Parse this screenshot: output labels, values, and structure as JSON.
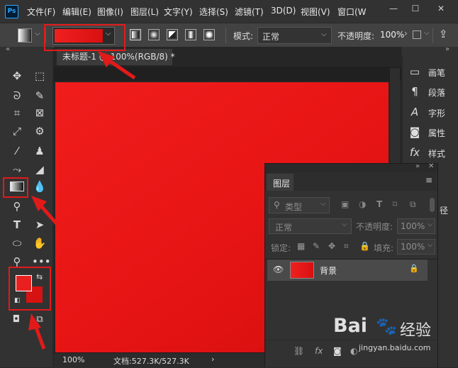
{
  "menubar": {
    "logo": "Ps",
    "items": [
      "文件(F)",
      "编辑(E)",
      "图像(I)",
      "图层(L)",
      "文字(Y)",
      "选择(S)",
      "滤镜(T)",
      "3D(D)",
      "视图(V)",
      "窗口(W"
    ]
  },
  "options": {
    "mode_label": "模式:",
    "mode_value": "正常",
    "opacity_label": "不透明度:",
    "opacity_value": "100%",
    "gradient_color": "#e81515"
  },
  "document": {
    "tab_title": "未标题-1 @ 100%(RGB/8) *",
    "zoom": "100%",
    "doc_info": "文档:527.3K/527.3K"
  },
  "colors": {
    "foreground": "#e82020",
    "background": "#d61212",
    "highlight": "#e21a1a"
  },
  "right_panel": {
    "items": [
      {
        "label": "画笔",
        "icon": "brush-icon"
      },
      {
        "label": "段落",
        "icon": "paragraph-icon"
      },
      {
        "label": "字形",
        "icon": "glyph-icon"
      },
      {
        "label": "属性",
        "icon": "properties-icon"
      },
      {
        "label": "样式",
        "icon": "styles-icon"
      }
    ],
    "partial_label": "径"
  },
  "layers_panel": {
    "title": "图层",
    "filter_label": "类型",
    "blend_mode": "正常",
    "opacity_label": "不透明度:",
    "opacity_value": "100%",
    "lock_label": "锁定:",
    "fill_label": "填充:",
    "fill_value": "100%",
    "layer_name": "背景"
  },
  "watermark": {
    "text": "Bai",
    "text2": "经验",
    "url": "jingyan.baidu.com"
  }
}
